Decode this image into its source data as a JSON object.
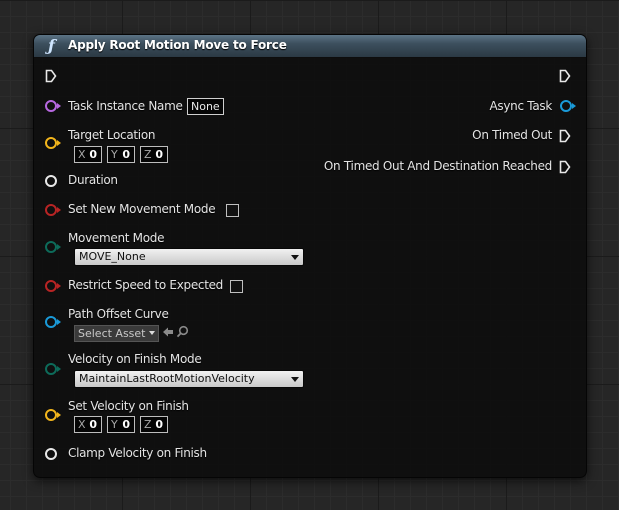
{
  "node": {
    "title": "Apply Root Motion Move to Force",
    "icon": "function-icon",
    "header_colors": [
      "#5b7385",
      "#2b3944"
    ]
  },
  "inputs": {
    "task_instance_name": {
      "label": "Task Instance Name",
      "value": "None",
      "pin_color": "#b768e0"
    },
    "target_location": {
      "label": "Target Location",
      "x_axis": "X",
      "x": "0",
      "y_axis": "Y",
      "y": "0",
      "z_axis": "Z",
      "z": "0",
      "pin_color": "#f2b51c"
    },
    "duration": {
      "label": "Duration"
    },
    "set_new_movement_mode": {
      "label": "Set New Movement Mode",
      "checked": false,
      "pin_color": "#b82424"
    },
    "movement_mode": {
      "label": "Movement Mode",
      "selected": "MOVE_None",
      "pin_color": "#0d6b5a"
    },
    "restrict_speed": {
      "label": "Restrict Speed to Expected",
      "checked": false,
      "pin_color": "#b82424"
    },
    "path_offset_curve": {
      "label": "Path Offset Curve",
      "asset_text": "Select Asset",
      "pin_color": "#1a9ad8"
    },
    "velocity_on_finish_mode": {
      "label": "Velocity on Finish Mode",
      "selected": "MaintainLastRootMotionVelocity",
      "pin_color": "#0d6b5a"
    },
    "set_velocity_on_finish": {
      "label": "Set Velocity on Finish",
      "x_axis": "X",
      "x": "0",
      "y_axis": "Y",
      "y": "0",
      "z_axis": "Z",
      "z": "0",
      "pin_color": "#f2b51c"
    },
    "clamp_velocity_on_finish": {
      "label": "Clamp Velocity on Finish"
    }
  },
  "outputs": {
    "async_task": {
      "label": "Async Task",
      "pin_color": "#1a9ad8"
    },
    "on_timed_out": {
      "label": "On Timed Out"
    },
    "on_timed_out_and_destination_reached": {
      "label": "On Timed Out And Destination Reached"
    }
  }
}
